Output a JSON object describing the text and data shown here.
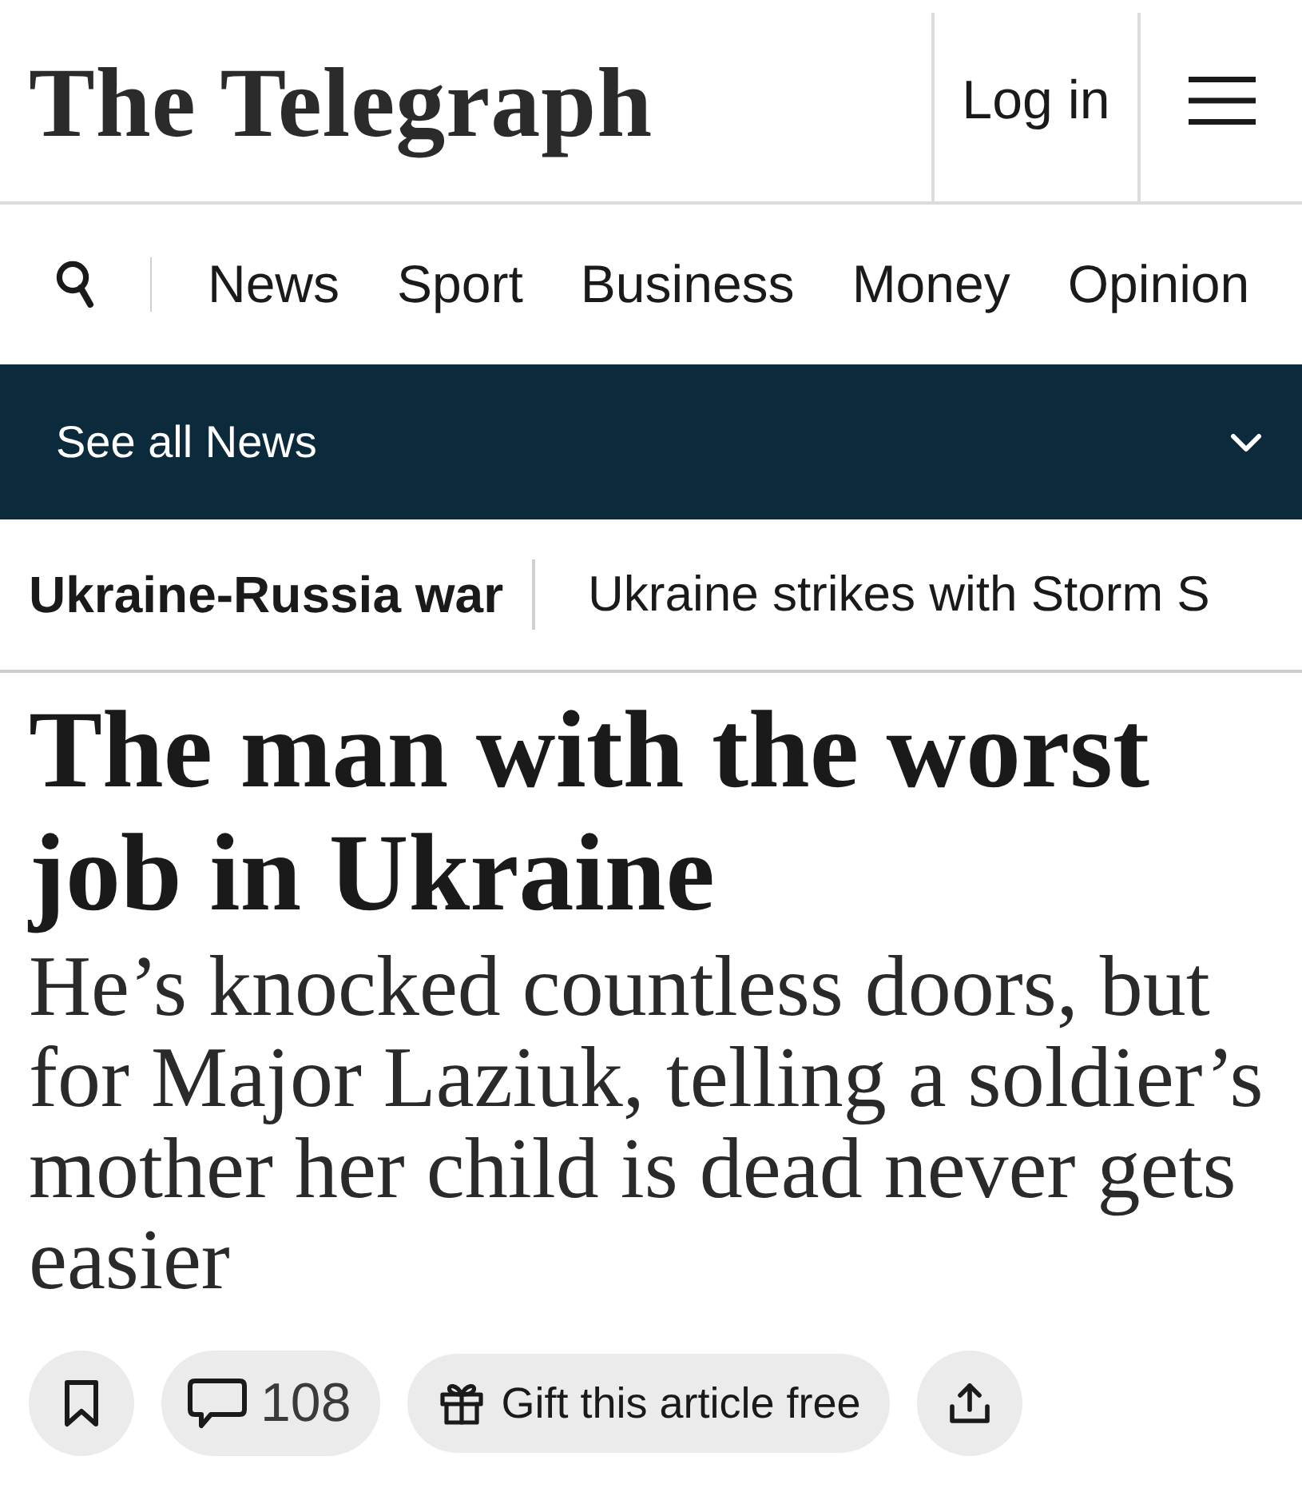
{
  "header": {
    "logo": "The Telegraph",
    "login": "Log in"
  },
  "nav": {
    "items": [
      {
        "label": "News"
      },
      {
        "label": "Sport"
      },
      {
        "label": "Business"
      },
      {
        "label": "Money"
      },
      {
        "label": "Opinion"
      }
    ]
  },
  "section_bar": {
    "label": "See all News",
    "expanded": false
  },
  "breadcrumb": {
    "section": "Ukraine-Russia war",
    "related": "Ukraine strikes with Storm S"
  },
  "article": {
    "headline": "The man with the worst job in Ukraine",
    "standfirst": "He’s knocked countless doors, but for Major Laziuk, telling a soldier’s mother her child is dead never gets easier"
  },
  "actions": {
    "comments": "108",
    "gift": "Gift this article free"
  }
}
